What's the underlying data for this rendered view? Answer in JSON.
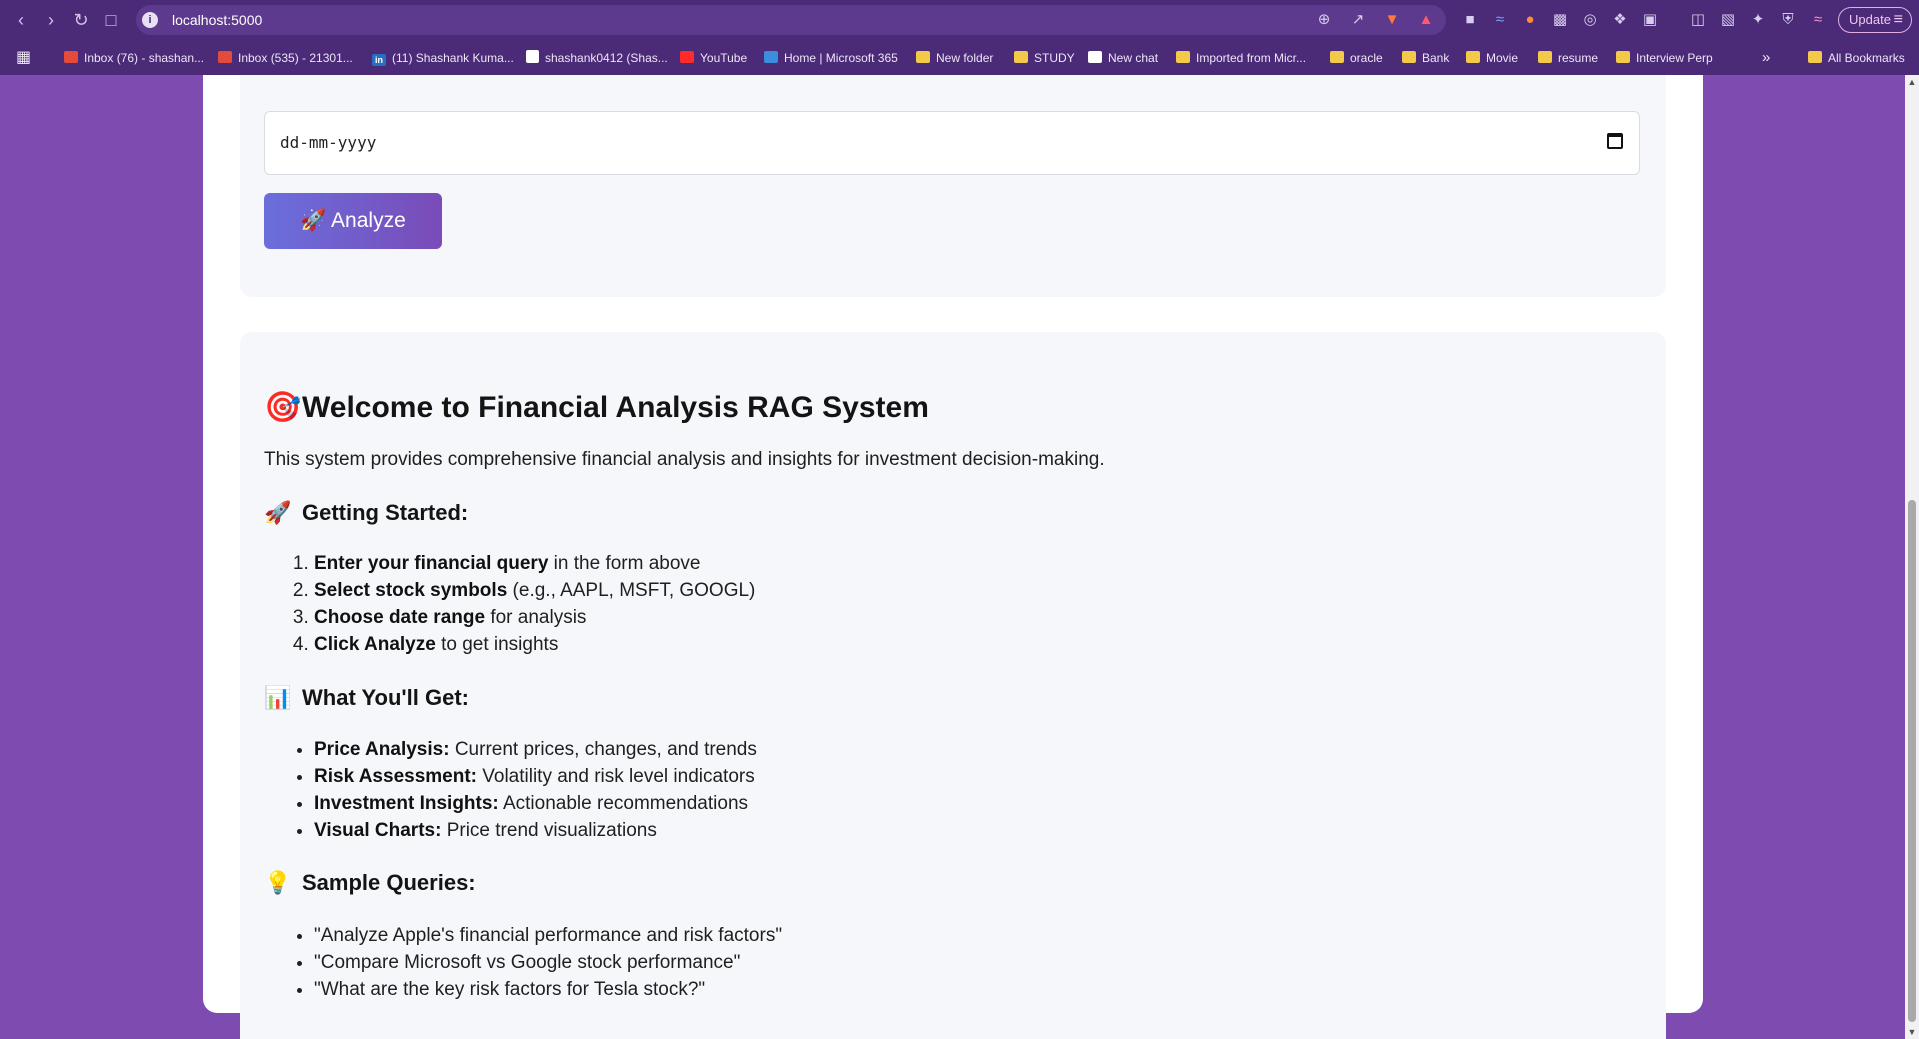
{
  "browser": {
    "url": "localhost:5000",
    "update_label": "Update",
    "bookmarks": [
      {
        "label": "Inbox (76) - shashan...",
        "icon": "gmail-icon"
      },
      {
        "label": "Inbox (535) - 21301...",
        "icon": "gmail-icon"
      },
      {
        "label": "(11) Shashank Kuma...",
        "icon": "linkedin-icon"
      },
      {
        "label": "shashank0412 (Shas...",
        "icon": "github-icon"
      },
      {
        "label": "YouTube",
        "icon": "youtube-icon"
      },
      {
        "label": "Home | Microsoft 365",
        "icon": "microsoft-icon"
      },
      {
        "label": "New folder",
        "icon": "folder-icon"
      },
      {
        "label": "STUDY",
        "icon": "folder-icon"
      },
      {
        "label": "New chat",
        "icon": "chatgpt-icon"
      },
      {
        "label": "Imported from Micr...",
        "icon": "folder-icon"
      },
      {
        "label": "oracle",
        "icon": "folder-icon"
      },
      {
        "label": "Bank",
        "icon": "folder-icon"
      },
      {
        "label": "Movie",
        "icon": "folder-icon"
      },
      {
        "label": "resume",
        "icon": "folder-icon"
      },
      {
        "label": "Interview Perp",
        "icon": "folder-icon"
      }
    ],
    "all_bookmarks_label": "All Bookmarks",
    "colors": {
      "chrome": "#4b2a78",
      "page_bg": "#7e4bb0"
    }
  },
  "form": {
    "date_placeholder": "dd-mm-yyyy",
    "analyze_label": "🚀 Analyze"
  },
  "welcome": {
    "title_emoji": "🎯",
    "title": "Welcome to Financial Analysis RAG System",
    "description": "This system provides comprehensive financial analysis and insights for investment decision-making.",
    "getting_started": {
      "emoji": "🚀",
      "heading": "Getting Started:",
      "steps": [
        {
          "bold": "Enter your financial query",
          "rest": " in the form above"
        },
        {
          "bold": "Select stock symbols",
          "rest": " (e.g., AAPL, MSFT, GOOGL)"
        },
        {
          "bold": "Choose date range",
          "rest": " for analysis"
        },
        {
          "bold": "Click Analyze",
          "rest": " to get insights"
        }
      ]
    },
    "what_you_get": {
      "emoji": "📊",
      "heading": "What You'll Get:",
      "items": [
        {
          "bold": "Price Analysis:",
          "rest": " Current prices, changes, and trends"
        },
        {
          "bold": "Risk Assessment:",
          "rest": " Volatility and risk level indicators"
        },
        {
          "bold": "Investment Insights:",
          "rest": " Actionable recommendations"
        },
        {
          "bold": "Visual Charts:",
          "rest": " Price trend visualizations"
        }
      ]
    },
    "sample_queries": {
      "emoji": "💡",
      "heading": "Sample Queries:",
      "items": [
        "\"Analyze Apple's financial performance and risk factors\"",
        "\"Compare Microsoft vs Google stock performance\"",
        "\"What are the key risk factors for Tesla stock?\""
      ]
    }
  }
}
